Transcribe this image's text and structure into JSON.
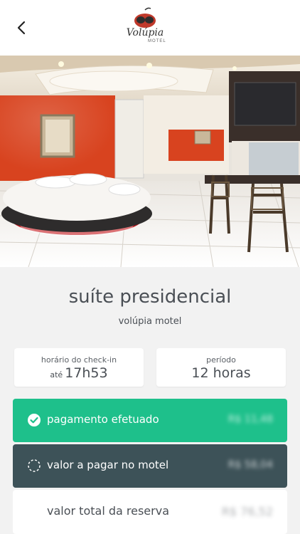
{
  "header": {
    "back_icon": "chevron-left-icon",
    "logo": {
      "name": "Volúpia",
      "sub": "MOTEL"
    }
  },
  "suite": {
    "name": "suíte presidencial",
    "motel": "volúpia motel"
  },
  "checkin": {
    "label": "horário do check-in",
    "prefix": "até",
    "time": "17h53"
  },
  "period": {
    "label": "período",
    "value": "12 horas"
  },
  "payments": {
    "paid": {
      "label": "pagamento efetuado",
      "amount": "R$ 11,48",
      "icon": "check-circle-icon",
      "color": "#1ec08b"
    },
    "due": {
      "label": "valor a pagar no motel",
      "amount": "R$ 58,04",
      "icon": "dashed-circle-icon",
      "color": "#3d5258"
    },
    "total": {
      "label": "valor total da reserva",
      "amount": "R$ 76,52"
    }
  }
}
